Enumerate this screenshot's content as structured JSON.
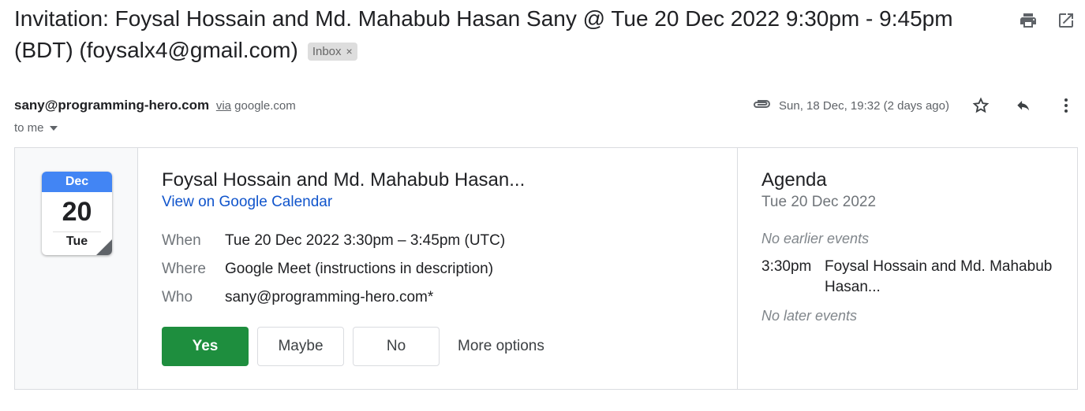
{
  "subject": "Invitation: Foysal Hossain and Md. Mahabub Hasan Sany @ Tue 20 Dec 2022 9:30pm - 9:45pm (BDT) (foysalx4@gmail.com)",
  "label": {
    "text": "Inbox",
    "remove": "×"
  },
  "sender": {
    "email": "sany@programming-hero.com",
    "via_word": "via",
    "via_domain": "google.com"
  },
  "recipient": "to me",
  "timestamp": "Sun, 18 Dec, 19:32 (2 days ago)",
  "calendar_icon": {
    "month": "Dec",
    "day": "20",
    "weekday": "Tue"
  },
  "event": {
    "title": "Foysal Hossain and Md. Mahabub Hasan...",
    "link": "View on Google Calendar",
    "when_label": "When",
    "when": "Tue 20 Dec 2022 3:30pm – 3:45pm (UTC)",
    "where_label": "Where",
    "where": "Google Meet (instructions in description)",
    "who_label": "Who",
    "who": "sany@programming-hero.com*"
  },
  "rsvp": {
    "yes": "Yes",
    "maybe": "Maybe",
    "no": "No",
    "more": "More options"
  },
  "agenda": {
    "title": "Agenda",
    "date": "Tue 20 Dec 2022",
    "no_earlier": "No earlier events",
    "event_time": "3:30pm",
    "event_name": "Foysal Hossain and Md. Mahabub Hasan...",
    "no_later": "No later events"
  },
  "icons": {
    "print": "print-icon",
    "open_new_window": "open-in-new-icon",
    "attachment": "paperclip-icon",
    "star": "star-icon",
    "reply": "reply-icon",
    "more": "more-vert-icon",
    "dropdown": "caret-down-icon"
  },
  "colors": {
    "calendar_blue": "#4285f4",
    "yes_green": "#1e8e3e",
    "link_blue": "#1155cc"
  }
}
